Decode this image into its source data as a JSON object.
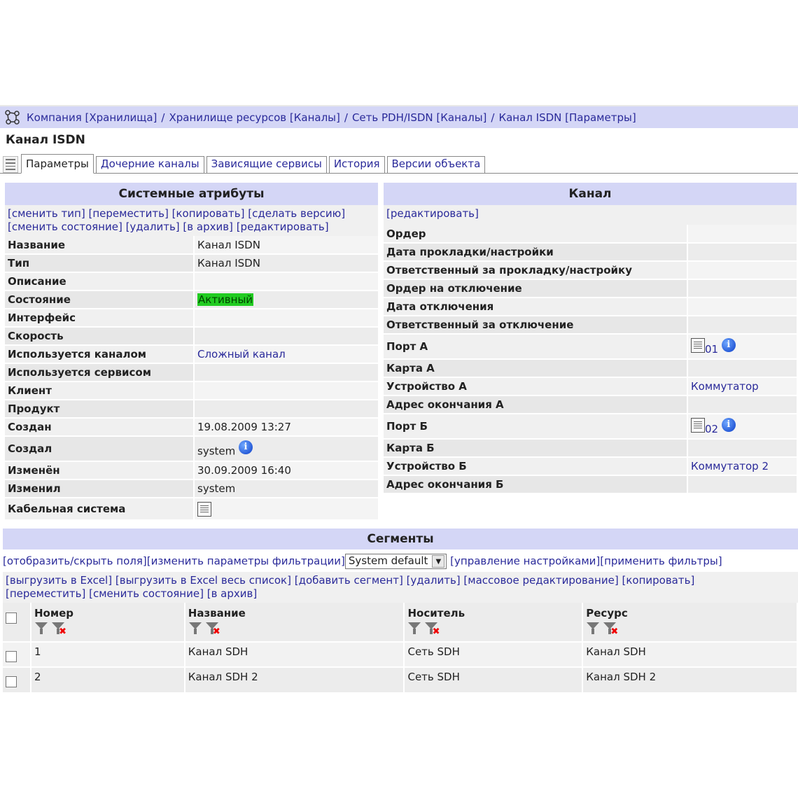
{
  "breadcrumb": {
    "items": [
      "Компания [Хранилища]",
      "Хранилище ресурсов [Каналы]",
      "Сеть PDH/ISDN [Каналы]",
      "Канал ISDN [Параметры]"
    ],
    "separator": "/"
  },
  "page_title": "Канал ISDN",
  "tabs": [
    "Параметры",
    "Дочерние каналы",
    "Зависящие сервисы",
    "История",
    "Версии объекта"
  ],
  "system_attributes": {
    "title": "Системные атрибуты",
    "actions_line1": [
      "[сменить тип]",
      "[переместить]",
      "[копировать]",
      "[сделать версию]"
    ],
    "actions_line2": [
      "[сменить состояние]",
      "[удалить]",
      "[в архив]",
      "[редактировать]"
    ],
    "rows": [
      {
        "key": "Название",
        "value": "Канал ISDN"
      },
      {
        "key": "Тип",
        "value": "Канал ISDN"
      },
      {
        "key": "Описание",
        "value": ""
      },
      {
        "key": "Состояние",
        "value": "Активный"
      },
      {
        "key": "Интерфейс",
        "value": ""
      },
      {
        "key": "Скорость",
        "value": ""
      },
      {
        "key": "Используется каналом",
        "value": "Сложный канал"
      },
      {
        "key": "Используется сервисом",
        "value": ""
      },
      {
        "key": "Клиент",
        "value": ""
      },
      {
        "key": "Продукт",
        "value": ""
      },
      {
        "key": "Создан",
        "value": "19.08.2009 13:27"
      },
      {
        "key": "Создал",
        "value": "system"
      },
      {
        "key": "Изменён",
        "value": "30.09.2009 16:40"
      },
      {
        "key": "Изменил",
        "value": "system"
      },
      {
        "key": "Кабельная система",
        "value": ""
      }
    ]
  },
  "channel": {
    "title": "Канал",
    "action": "[редактировать]",
    "rows": [
      {
        "key": "Ордер",
        "value": ""
      },
      {
        "key": "Дата прокладки/настройки",
        "value": ""
      },
      {
        "key": "Ответственный за прокладку/настройку",
        "value": ""
      },
      {
        "key": "Ордер на отключение",
        "value": ""
      },
      {
        "key": "Дата отключения",
        "value": ""
      },
      {
        "key": "Ответственный за отключение",
        "value": ""
      },
      {
        "key": "Порт А",
        "value": "01"
      },
      {
        "key": "Карта А",
        "value": ""
      },
      {
        "key": "Устройство А",
        "value": "Коммутатор"
      },
      {
        "key": "Адрес окончания А",
        "value": ""
      },
      {
        "key": "Порт Б",
        "value": "02"
      },
      {
        "key": "Карта Б",
        "value": ""
      },
      {
        "key": "Устройство Б",
        "value": "Коммутатор 2"
      },
      {
        "key": "Адрес окончания Б",
        "value": ""
      }
    ]
  },
  "segments": {
    "title": "Сегменты",
    "filter_links_before": [
      "[отобразить/скрыть поля]",
      "[изменить параметры фильтрации]"
    ],
    "select_value": "System default",
    "filter_links_after": [
      "[управление настройками]",
      "[применить фильтры]"
    ],
    "actions_line1": [
      "[выгрузить в Excel]",
      "[выгрузить в Excel весь список]",
      "[добавить сегмент]",
      "[удалить]",
      "[массовое редактирование]",
      "[копировать]"
    ],
    "actions_line2": [
      "[переместить]",
      "[сменить состояние]",
      "[в архив]"
    ],
    "columns": [
      "Номер",
      "Название",
      "Носитель",
      "Ресурс"
    ],
    "rows": [
      [
        "1",
        "Канал SDH",
        "Сеть SDH",
        "Канал SDH"
      ],
      [
        "2",
        "Канал SDH 2",
        "Сеть SDH",
        "Канал SDH 2"
      ]
    ]
  }
}
